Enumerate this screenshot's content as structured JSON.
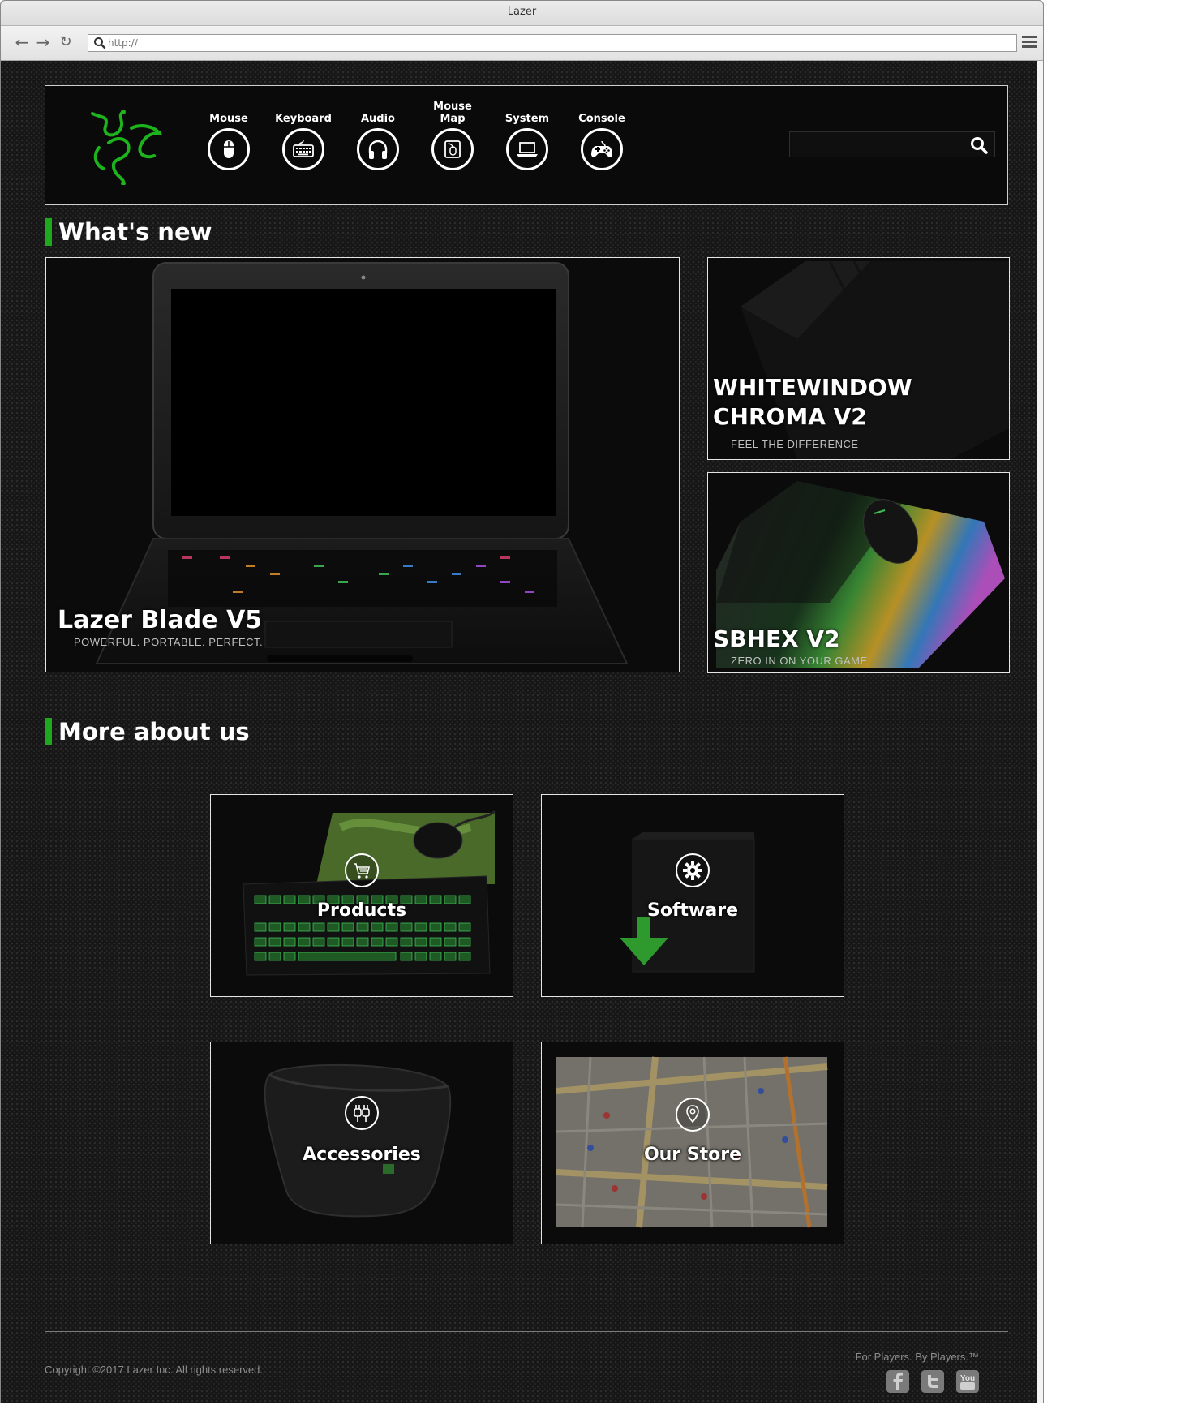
{
  "browser": {
    "title": "Lazer",
    "url_placeholder": "http://"
  },
  "header": {
    "logo": "razer-snake-logo",
    "categories": [
      {
        "label": "Mouse",
        "icon": "mouse-icon"
      },
      {
        "label": "Keyboard",
        "icon": "keyboard-icon"
      },
      {
        "label": "Audio",
        "icon": "headphones-icon"
      },
      {
        "label": "Mouse Map",
        "icon": "mousepad-icon"
      },
      {
        "label": "System",
        "icon": "laptop-icon"
      },
      {
        "label": "Console",
        "icon": "gamepad-icon"
      }
    ],
    "search_placeholder": ""
  },
  "whats_new": {
    "heading": "What's new",
    "featured": {
      "title": "Lazer Blade V5",
      "subtitle": "POWERFUL. PORTABLE. PERFECT."
    },
    "side": [
      {
        "title": "WHITEWINDOW CHROMA V2",
        "subtitle": "FEEL THE DIFFERENCE"
      },
      {
        "title": "SBHEX V2",
        "subtitle": "ZERO IN ON YOUR GAME"
      }
    ]
  },
  "more_about": {
    "heading": "More about us",
    "tiles": [
      {
        "label": "Products",
        "icon": "shopping-cart-icon"
      },
      {
        "label": "Software",
        "icon": "gear-icon"
      },
      {
        "label": "Accessories",
        "icon": "plug-icon"
      },
      {
        "label": "Our Store",
        "icon": "map-pin-icon"
      }
    ]
  },
  "footer": {
    "copyright": "Copyright ©2017 Lazer Inc. All rights reserved.",
    "tagline": "For Players. By Players.™",
    "social": [
      "facebook-icon",
      "twitter-icon",
      "youtube-icon"
    ],
    "youtube_label": "You"
  },
  "colors": {
    "accent_green": "#1ea81e",
    "background": "#161616",
    "text": "#ffffff"
  }
}
